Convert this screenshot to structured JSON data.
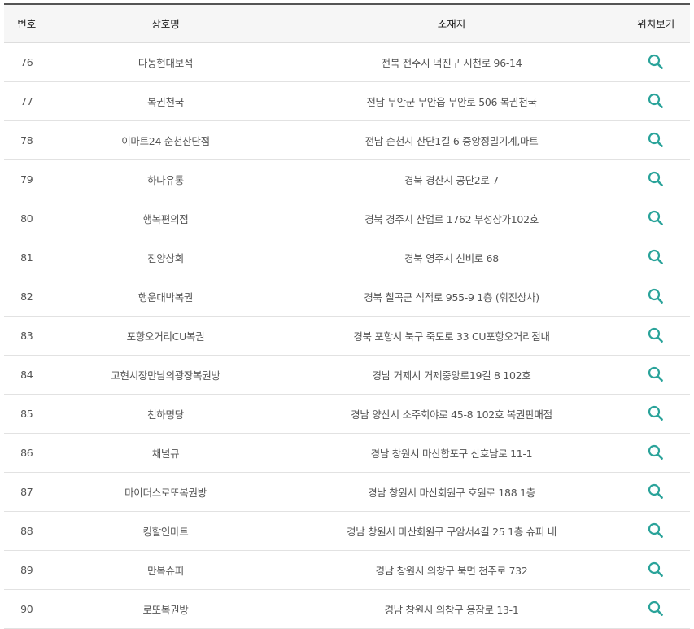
{
  "table": {
    "headers": [
      "번호",
      "상호명",
      "소재지",
      "위치보기"
    ],
    "rows": [
      {
        "no": "76",
        "name": "다농현대보석",
        "address": "전북 전주시 덕진구 시천로 96-14"
      },
      {
        "no": "77",
        "name": "복권천국",
        "address": "전남 무안군 무안읍 무안로 506 복권천국"
      },
      {
        "no": "78",
        "name": "이마트24 순천산단점",
        "address": "전남 순천시 산단1길 6 중앙정밀기계,마트"
      },
      {
        "no": "79",
        "name": "하나유통",
        "address": "경북 경산시 공단2로 7"
      },
      {
        "no": "80",
        "name": "행복편의점",
        "address": "경북 경주시 산업로 1762 부성상가102호"
      },
      {
        "no": "81",
        "name": "진양상회",
        "address": "경북 영주시 선비로 68"
      },
      {
        "no": "82",
        "name": "행운대박복권",
        "address": "경북 칠곡군 석적로 955-9 1층 (휘진상사)"
      },
      {
        "no": "83",
        "name": "포항오거리CU복권",
        "address": "경북 포항시 북구 죽도로 33 CU포항오거리점내"
      },
      {
        "no": "84",
        "name": "고현시장만남의광장복권방",
        "address": "경남 거제시 거제중앙로19길 8 102호"
      },
      {
        "no": "85",
        "name": "천하명당",
        "address": "경남 양산시 소주회야로 45-8 102호 복권판매점"
      },
      {
        "no": "86",
        "name": "채널큐",
        "address": "경남 창원시 마산합포구 산호남로 11-1"
      },
      {
        "no": "87",
        "name": "마이더스로또복권방",
        "address": "경남 창원시 마산회원구 호원로 188 1층"
      },
      {
        "no": "88",
        "name": "킹할인마트",
        "address": "경남 창원시 마산회원구 구암서4길 25 1층 슈퍼 내"
      },
      {
        "no": "89",
        "name": "만복슈퍼",
        "address": "경남 창원시 의창구 북면 천주로 732"
      },
      {
        "no": "90",
        "name": "로또복권방",
        "address": "경남 창원시 의창구 용잠로 13-1"
      }
    ],
    "search_icon": "search-icon",
    "icon_color": "#2aa39a"
  }
}
